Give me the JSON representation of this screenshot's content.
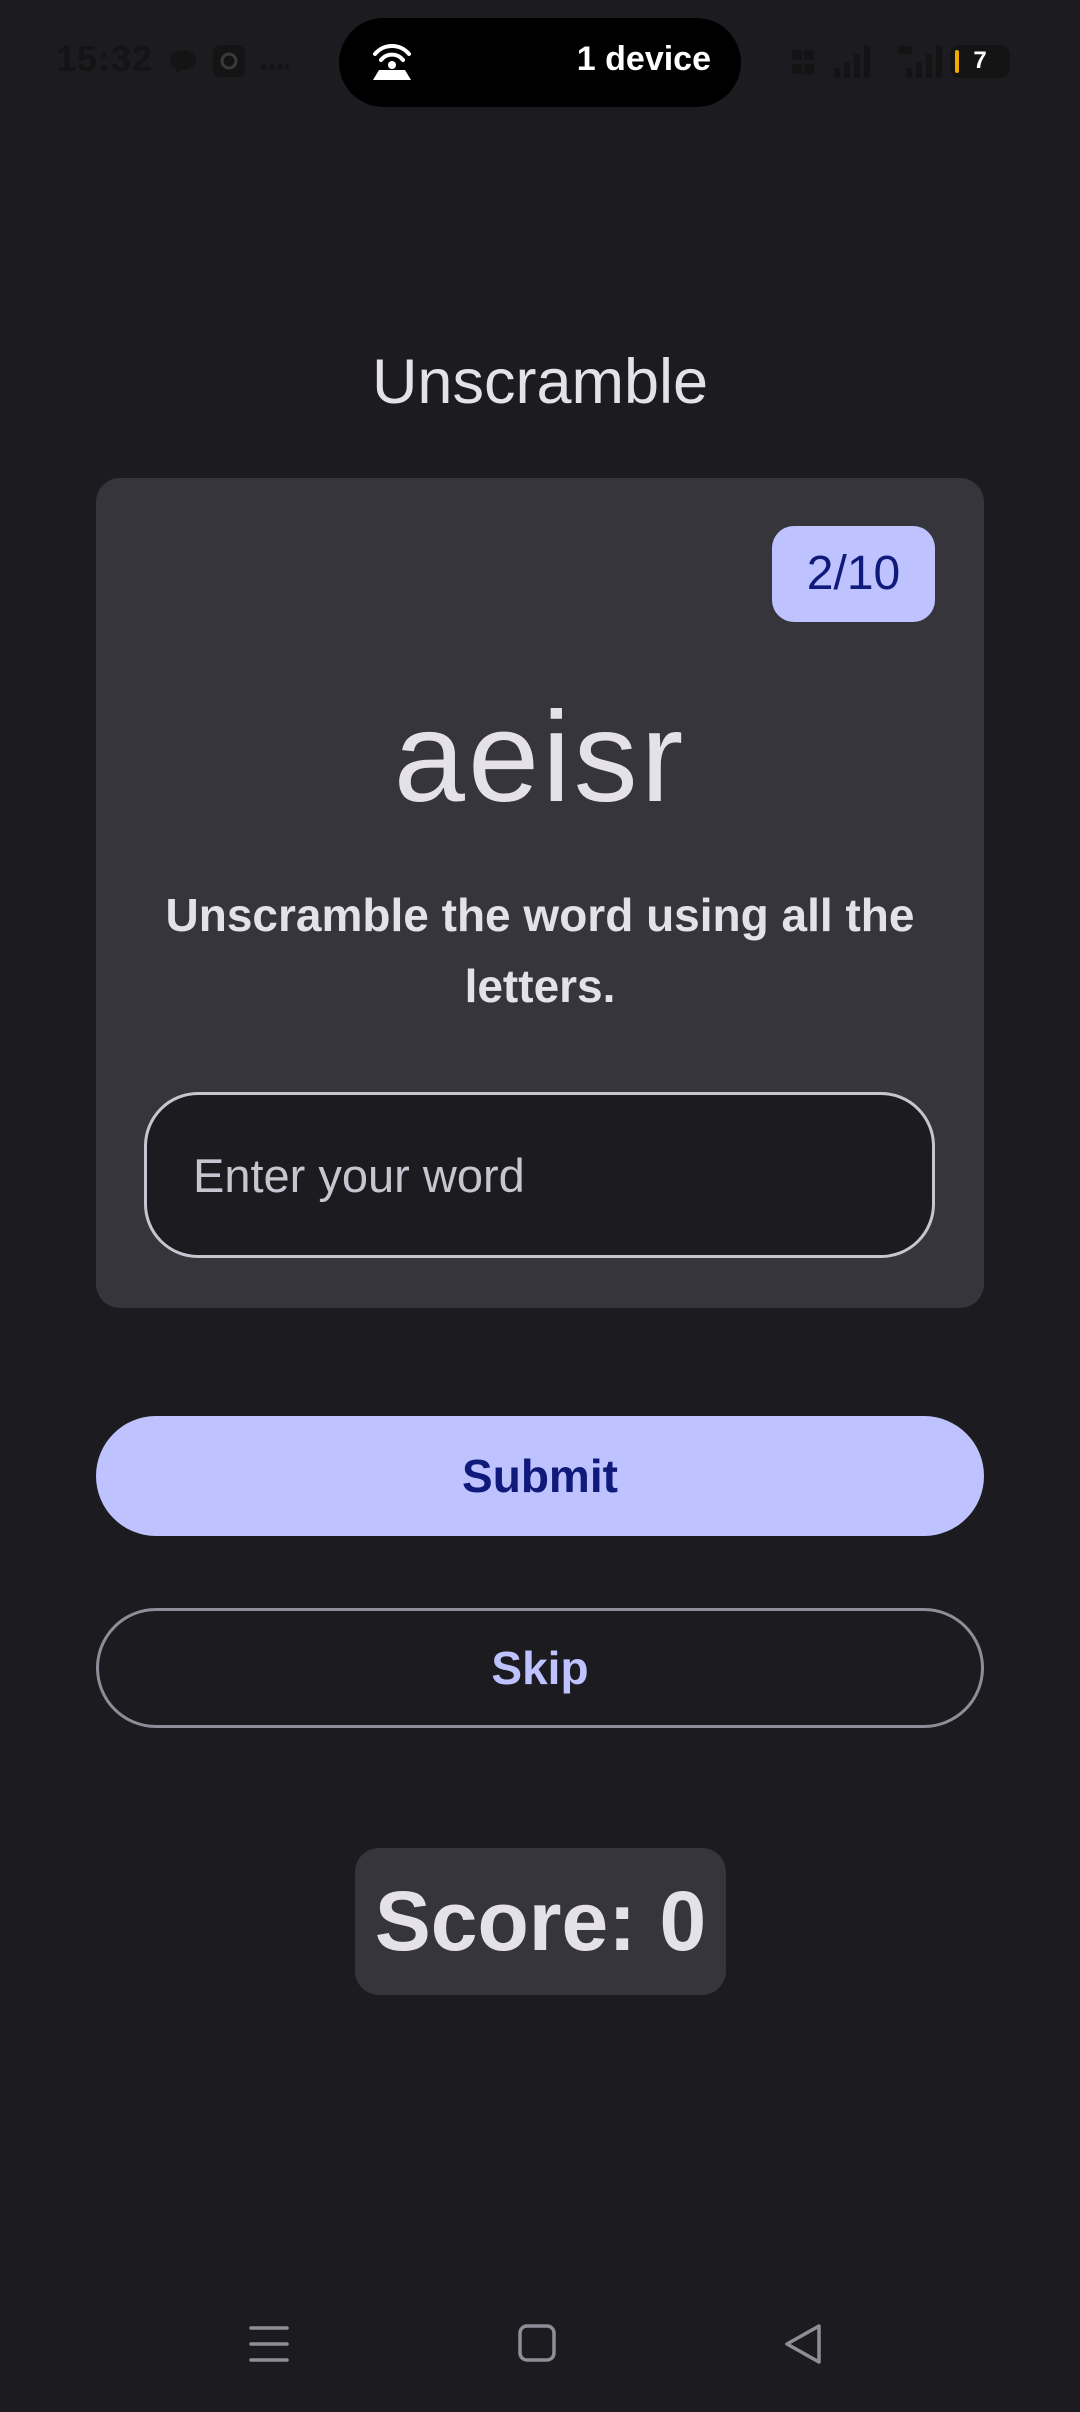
{
  "status_bar": {
    "time": "15:32",
    "island_text": "1 device",
    "battery_level": "7",
    "icons": [
      "chat-bubble-icon",
      "app-notification-icon",
      "more-dots-icon",
      "hotspot-icon",
      "volte-icon",
      "signal-icon",
      "5g-signal-icon",
      "battery-icon"
    ]
  },
  "app": {
    "title": "Unscramble"
  },
  "card": {
    "progress": "2/10",
    "scrambled_word": "aeisr",
    "instructions": "Unscramble the word using all the letters.",
    "input": {
      "value": "",
      "placeholder": "Enter your word"
    }
  },
  "buttons": {
    "submit_label": "Submit",
    "skip_label": "Skip"
  },
  "score": {
    "text": "Score: 0"
  },
  "nav_bar": {
    "items": [
      "menu-icon",
      "home-icon",
      "back-icon"
    ]
  },
  "colors": {
    "background": "#1c1b20",
    "card": "#36353b",
    "primary": "#bec2ff",
    "on_primary": "#101a7a",
    "outline": "#8f8e98"
  }
}
